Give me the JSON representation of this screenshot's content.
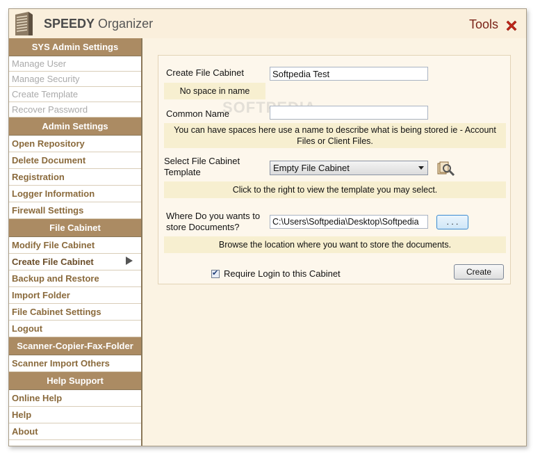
{
  "app": {
    "title_bold": "SPEEDY",
    "title_rest": "Organizer",
    "tools_label": "Tools"
  },
  "colors": {
    "accent": "#ab8b63",
    "close": "#c0261a",
    "hint_bg": "#f7efd0"
  },
  "sidebar": {
    "sections": [
      {
        "header": "SYS Admin Settings",
        "items": [
          {
            "label": "Manage User",
            "state": "disabled"
          },
          {
            "label": "Manage Security",
            "state": "disabled"
          },
          {
            "label": "Create Template",
            "state": "disabled"
          },
          {
            "label": "Recover Password",
            "state": "disabled"
          }
        ]
      },
      {
        "header": "Admin Settings",
        "items": [
          {
            "label": "Open Repository"
          },
          {
            "label": "Delete Document"
          },
          {
            "label": "Registration"
          },
          {
            "label": "Logger Information"
          },
          {
            "label": "Firewall Settings"
          }
        ]
      },
      {
        "header": "File Cabinet",
        "items": [
          {
            "label": "Modify File Cabinet"
          },
          {
            "label": "Create File Cabinet",
            "state": "active"
          },
          {
            "label": "Backup and Restore"
          },
          {
            "label": "Import Folder"
          },
          {
            "label": "File Cabinet Settings"
          },
          {
            "label": "Logout"
          }
        ]
      },
      {
        "header": "Scanner-Copier-Fax-Folder",
        "items": [
          {
            "label": "Scanner Import  Others"
          }
        ]
      },
      {
        "header": "Help  Support",
        "items": [
          {
            "label": "Online Help"
          },
          {
            "label": "Help"
          },
          {
            "label": "About"
          }
        ]
      }
    ]
  },
  "form": {
    "cabinet_label": "Create File Cabinet",
    "cabinet_value": "Softpedia Test",
    "cabinet_hint": "No space in name",
    "common_label": "Common Name",
    "common_value": "",
    "common_hint": "You can have spaces here use a name to describe what is being stored ie - Account Files or Client Files.",
    "template_label": "Select File Cabinet Template",
    "template_value": "Empty File Cabinet",
    "template_hint": "Click to the right to view the template you may select.",
    "store_label": "Where Do you wants to store Documents?",
    "store_value": "C:\\Users\\Softpedia\\Desktop\\Softpedia",
    "browse_label": ". . .",
    "store_hint": "Browse the location where you want to store the documents.",
    "require_login_label": "Require Login to this Cabinet",
    "require_login_checked": true,
    "create_label": "Create",
    "watermark": "SOFTPEDIA"
  }
}
